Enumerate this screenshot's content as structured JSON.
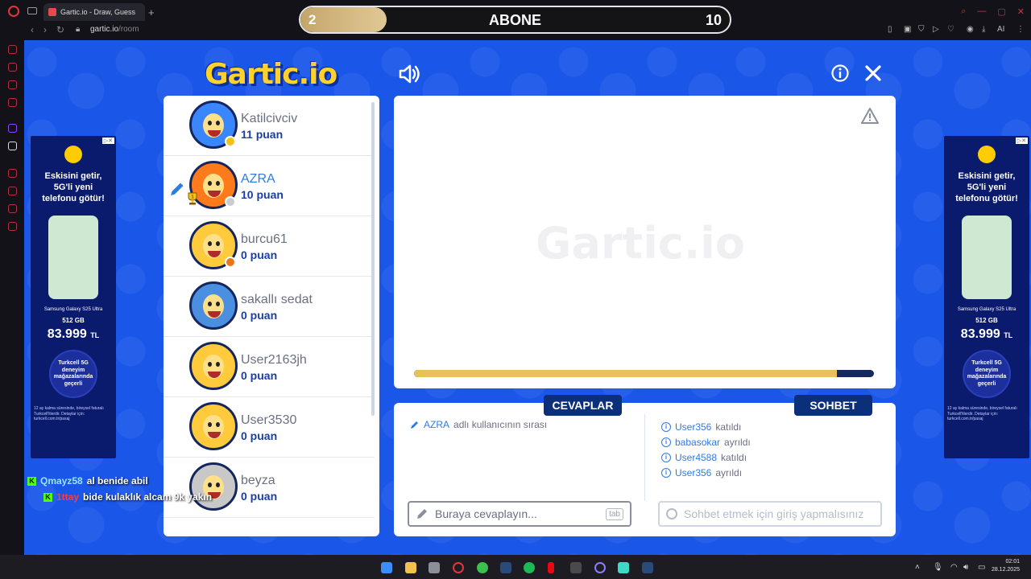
{
  "browser": {
    "tab_title": "Gartic.io - Draw, Guess",
    "url_host": "gartic.io",
    "url_path": "/room",
    "ai_label": "AI"
  },
  "overlay": {
    "sub_current": "2",
    "sub_title": "ABONE",
    "sub_goal": "10",
    "sub_progress": 0.2
  },
  "game": {
    "logo": "Gartic.io",
    "players": [
      {
        "name": "Katilcivciv",
        "score": "11 puan",
        "avatar": "blue",
        "dot": "#f2c21a",
        "active": false
      },
      {
        "name": "AZRA",
        "score": "10 puan",
        "avatar": "orange",
        "dot": "#c9ccd4",
        "active": true
      },
      {
        "name": "burcu61",
        "score": "0 puan",
        "avatar": "yellow",
        "dot": "#e8761b",
        "active": false
      },
      {
        "name": "sakallı sedat",
        "score": "0 puan",
        "avatar": "beard",
        "dot": "",
        "active": false
      },
      {
        "name": "User2163jh",
        "score": "0 puan",
        "avatar": "yellow",
        "dot": "",
        "active": false
      },
      {
        "name": "User3530",
        "score": "0 puan",
        "avatar": "yellow",
        "dot": "",
        "active": false
      },
      {
        "name": "beyza",
        "score": "0 puan",
        "avatar": "photo",
        "dot": "",
        "active": false
      }
    ],
    "trophy_rank": "1",
    "canvas_watermark": "Gartic.io",
    "timer_progress": 0.92,
    "answers_tab": "CEVAPLAR",
    "chat_tab": "SOHBET",
    "turn_user": "AZRA",
    "turn_text": "adlı kullanıcının sırası",
    "chat_log": [
      {
        "user": "User356",
        "action": "katıldı"
      },
      {
        "user": "babasokar",
        "action": "ayrıldı"
      },
      {
        "user": "User4588",
        "action": "katıldı"
      },
      {
        "user": "User356",
        "action": "ayrıldı"
      }
    ],
    "answer_placeholder": "Buraya cevaplayın...",
    "answer_key": "tab",
    "chat_placeholder": "Sohbet etmek için giriş yapmalısınız"
  },
  "ad": {
    "headline": "Eskisini getir, 5G'li yeni telefonu götür!",
    "model": "Samsung Galaxy S25 Ultra",
    "storage": "512 GB",
    "price": "83.999",
    "currency": "TL",
    "badge": "Turkcell 5G deneyim mağazalarında geçerli",
    "fine_print": "12 ay kalma süresinde, bireysel faturalı Turkcell'lilerdir. Detaylar için: turkcell.com.tr/pasaj"
  },
  "stream_chat": [
    {
      "user": "Qmayz58",
      "message": "al benide abil"
    },
    {
      "user": "1ttay",
      "message": "bide kulaklık alcam 9k yakın"
    }
  ],
  "taskbar": {
    "time": "02:01",
    "date": "28.12.2025"
  },
  "colors": {
    "game_bg": "#1a56e8",
    "accent_blue": "#2d7be5",
    "tab_navy": "#0b2f7a",
    "timer_gold": "#e6c25c"
  }
}
